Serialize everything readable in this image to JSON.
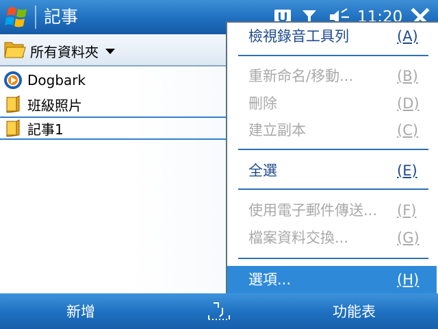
{
  "titlebar": {
    "title": "記事",
    "time": "11:20",
    "icons": [
      "windows-start-icon",
      "connectivity-icon",
      "signal-icon",
      "volume-icon",
      "close-icon"
    ]
  },
  "folder": {
    "label": "所有資料夾",
    "icon": "folder-open-icon"
  },
  "files": [
    {
      "name": "Dogbark",
      "icon": "media-icon"
    },
    {
      "name": "班級照片",
      "icon": "folder-icon"
    },
    {
      "name": "記事1",
      "icon": "folder-icon",
      "selected": true
    }
  ],
  "menu": {
    "items": [
      {
        "label": "檢視錄音工具列",
        "key": "(A)",
        "enabled": true
      },
      {
        "label": "重新命名/移動...",
        "key": "(B)",
        "enabled": false
      },
      {
        "label": "刪除",
        "key": "(D)",
        "enabled": false
      },
      {
        "label": "建立副本",
        "key": "(C)",
        "enabled": false
      },
      {
        "label": "全選",
        "key": "(E)",
        "enabled": true
      },
      {
        "label": "使用電子郵件傳送...",
        "key": "(F)",
        "enabled": false
      },
      {
        "label": "檔案資料交換...",
        "key": "(G)",
        "enabled": false
      },
      {
        "label": "選項...",
        "key": "(H)",
        "enabled": true,
        "highlighted": true
      }
    ]
  },
  "softkeys": {
    "left": "新增",
    "right": "功能表",
    "center_icon": "keyboard-icon"
  },
  "colors": {
    "titlebar": "#1f6fbf",
    "menu_text": "#1c4a8c",
    "disabled_text": "#a9a9a9",
    "highlight": "#2e8ad8"
  }
}
